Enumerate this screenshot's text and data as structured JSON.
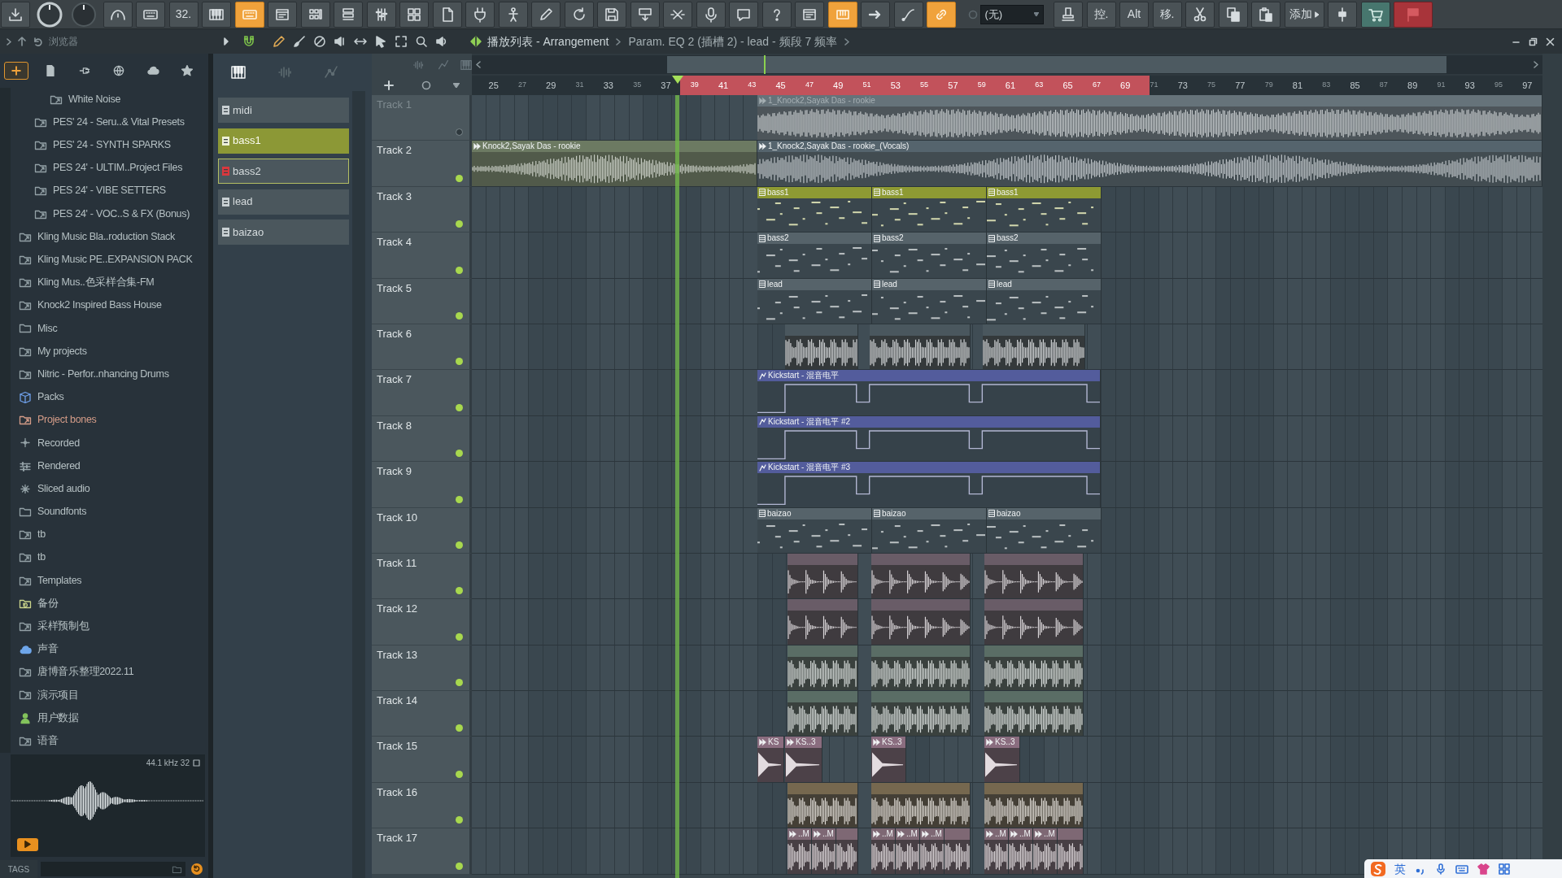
{
  "toolbar": {
    "left": [
      {
        "kind": "icon",
        "active": false
      },
      {
        "kind": "knob",
        "active": false
      },
      {
        "kind": "knob",
        "active": false
      },
      {
        "kind": "icon",
        "active": false
      },
      {
        "kind": "icon",
        "active": false
      },
      {
        "kind": "text",
        "label": "32.",
        "active": false
      },
      {
        "kind": "icon",
        "active": false
      },
      {
        "kind": "icon",
        "active": true
      },
      {
        "kind": "icon",
        "active": false
      },
      {
        "kind": "icon",
        "active": false
      },
      {
        "kind": "icon",
        "active": false
      },
      {
        "kind": "icon",
        "active": false
      },
      {
        "kind": "icon",
        "active": false
      },
      {
        "kind": "icon",
        "active": false
      },
      {
        "kind": "icon",
        "active": false
      },
      {
        "kind": "icon",
        "active": false
      },
      {
        "kind": "icon",
        "active": false
      },
      {
        "kind": "icon",
        "active": false
      },
      {
        "kind": "icon",
        "active": false
      },
      {
        "kind": "icon",
        "active": false
      },
      {
        "kind": "icon",
        "active": false
      },
      {
        "kind": "icon",
        "active": false
      },
      {
        "kind": "icon",
        "active": false
      },
      {
        "kind": "icon",
        "active": false
      },
      {
        "kind": "icon",
        "active": false
      },
      {
        "kind": "icon",
        "active": true
      },
      {
        "kind": "icon",
        "active": false
      },
      {
        "kind": "icon",
        "active": false
      },
      {
        "kind": "icon",
        "active": true
      }
    ],
    "selector": {
      "value": "(无)"
    },
    "right": [
      {
        "kind": "icon",
        "active": false
      },
      {
        "kind": "text",
        "label": "控.",
        "active": false
      },
      {
        "kind": "text",
        "label": "Alt",
        "active": false
      },
      {
        "kind": "text",
        "label": "移.",
        "active": false
      },
      {
        "kind": "icon",
        "active": false
      },
      {
        "kind": "icon",
        "active": false
      },
      {
        "kind": "icon",
        "active": false
      },
      {
        "kind": "menu",
        "label": "添加",
        "active": false
      },
      {
        "kind": "icon",
        "active": false
      },
      {
        "kind": "icon",
        "active": false
      },
      {
        "kind": "icon",
        "active": false
      }
    ]
  },
  "browser": {
    "title": "浏览器",
    "tabs": [
      {
        "selected": true
      },
      {
        "selected": false
      },
      {
        "selected": false
      },
      {
        "selected": false
      },
      {
        "selected": false
      },
      {
        "selected": false
      }
    ],
    "items": [
      {
        "children": [
          {
            "children": [
              {
                "label": "White Noise",
                "kind": "linked"
              }
            ]
          },
          {
            "label": "PES' 24 - Seru..& Vital Presets",
            "kind": "linked"
          },
          {
            "label": "PES' 24 - SYNTH SPARKS",
            "kind": "linked"
          },
          {
            "label": "PES 24' - ULTIM..Project Files",
            "kind": "linked"
          },
          {
            "label": "PES 24' - VIBE SETTERS",
            "kind": "linked"
          },
          {
            "label": "PES 24' - VOC..S & FX (Bonus)",
            "kind": "linked"
          }
        ]
      },
      {
        "label": "Kling Music Bla..roduction Stack",
        "kind": "linked"
      },
      {
        "label": "Kling Music PE..EXPANSION PACK",
        "kind": "linked"
      },
      {
        "label": "Kling Mus..色采样合集-FM",
        "kind": "linked"
      },
      {
        "label": "Knock2 Inspired Bass House",
        "kind": "linked"
      },
      {
        "label": "Misc",
        "kind": "folder"
      },
      {
        "label": "My projects",
        "kind": "linked"
      },
      {
        "label": "Nitric - Perfor..nhancing Drums",
        "kind": "linked"
      },
      {
        "label": "Packs",
        "kind": "packs"
      },
      {
        "label": "Project bones",
        "kind": "linked",
        "color": "#d49c88"
      },
      {
        "label": "Recorded",
        "kind": "recorded"
      },
      {
        "label": "Rendered",
        "kind": "rendered"
      },
      {
        "label": "Sliced audio",
        "kind": "sliced"
      },
      {
        "label": "Soundfonts",
        "kind": "folder"
      },
      {
        "label": "tb",
        "kind": "linked"
      },
      {
        "label": "tb",
        "kind": "linked"
      },
      {
        "label": "Templates",
        "kind": "linked"
      },
      {
        "label": "备份",
        "kind": "backup"
      },
      {
        "label": "采样预制包",
        "kind": "linked"
      },
      {
        "label": "声音",
        "kind": "cloud"
      },
      {
        "label": "唐博音乐整理2022.11",
        "kind": "linked"
      },
      {
        "label": "演示项目",
        "kind": "linked"
      },
      {
        "label": "用户数据",
        "kind": "user"
      },
      {
        "label": "语音",
        "kind": "linked"
      }
    ],
    "preview": {
      "info": "44.1 kHz 32"
    },
    "tags": {
      "label": "TAGS"
    }
  },
  "playlist": {
    "title": "播放列表 - Arrangement",
    "breadcrumb": "Param. EQ 2 (插槽 2) - lead - 频段 7 频率",
    "picker_filters": [
      {
        "selected": true
      },
      {
        "selected": false
      },
      {
        "selected": false
      }
    ],
    "patterns": [
      {
        "label": "midi",
        "selected": false,
        "focused": false,
        "color": "#c9d0d3"
      },
      {
        "label": "bass1",
        "selected": true,
        "focused": false,
        "color": "#eef1d8"
      },
      {
        "label": "bass2",
        "selected": false,
        "focused": true,
        "color": "#d9383e"
      },
      {
        "label": "lead",
        "selected": false,
        "focused": false,
        "color": "#c9d0d3"
      },
      {
        "label": "baizao",
        "selected": false,
        "focused": false,
        "color": "#c9d0d3"
      }
    ],
    "ruler": [
      "25",
      "27",
      "29",
      "31",
      "33",
      "35",
      "37",
      "39",
      "41",
      "43",
      "45",
      "47",
      "49",
      "51",
      "53",
      "55",
      "57",
      "59",
      "61",
      "63",
      "65",
      "67",
      "69",
      "71",
      "73",
      "75",
      "77",
      "79",
      "81",
      "83",
      "85",
      "87",
      "89",
      "91",
      "93",
      "95",
      "97"
    ],
    "tracks": [
      {
        "label": "Track 1",
        "muted": true,
        "clips": [
          {
            "kind": "audio",
            "label": "1_Knock2,Sayak Das - rookie",
            "color": "#66737a"
          }
        ]
      },
      {
        "label": "Track 2",
        "muted": false,
        "clips": [
          {
            "kind": "audio",
            "label": "Knock2,Sayak Das - rookie",
            "color": "#6c7a62"
          },
          {
            "kind": "audio",
            "label": "1_Knock2,Sayak Das - rookie_(Vocals)",
            "color": "#55646d"
          }
        ]
      },
      {
        "label": "Track 3",
        "muted": false,
        "clips": [
          {
            "kind": "pattern",
            "label": "bass1",
            "color": "#8e9a33"
          },
          {
            "kind": "pattern",
            "label": "bass1",
            "color": "#8e9a33"
          },
          {
            "kind": "pattern",
            "label": "bass1",
            "color": "#8e9a33"
          }
        ]
      },
      {
        "label": "Track 4",
        "muted": false,
        "clips": [
          {
            "kind": "pattern",
            "label": "bass2",
            "color": "#56636a"
          },
          {
            "kind": "pattern",
            "label": "bass2",
            "color": "#56636a"
          },
          {
            "kind": "pattern",
            "label": "bass2",
            "color": "#56636a"
          }
        ]
      },
      {
        "label": "Track 5",
        "muted": false,
        "clips": [
          {
            "kind": "pattern",
            "label": "lead",
            "color": "#56636a"
          },
          {
            "kind": "pattern",
            "label": "lead",
            "color": "#56636a"
          },
          {
            "kind": "pattern",
            "label": "lead",
            "color": "#56636a"
          }
        ]
      },
      {
        "label": "Track 6",
        "muted": false,
        "clips": [
          {
            "kind": "audio",
            "color": "#4a575e"
          },
          {
            "kind": "audio",
            "color": "#4a575e"
          },
          {
            "kind": "audio",
            "color": "#4a575e"
          }
        ]
      },
      {
        "label": "Track 7",
        "muted": false,
        "clips": [
          {
            "kind": "automation",
            "label": "Kickstart - 混音电平",
            "color": "#535c9c"
          }
        ]
      },
      {
        "label": "Track 8",
        "muted": false,
        "clips": [
          {
            "kind": "automation",
            "label": "Kickstart - 混音电平 #2",
            "color": "#535c9c"
          }
        ]
      },
      {
        "label": "Track 9",
        "muted": false,
        "clips": [
          {
            "kind": "automation",
            "label": "Kickstart - 混音电平 #3",
            "color": "#535c9c"
          }
        ]
      },
      {
        "label": "Track 10",
        "muted": false,
        "clips": [
          {
            "kind": "pattern",
            "label": "baizao",
            "color": "#56636a"
          },
          {
            "kind": "pattern",
            "label": "baizao",
            "color": "#56636a"
          },
          {
            "kind": "pattern",
            "label": "baizao",
            "color": "#56636a"
          }
        ]
      },
      {
        "label": "Track 11",
        "muted": false,
        "clips": [
          {
            "kind": "audio",
            "color": "#695c67"
          },
          {
            "kind": "audio",
            "color": "#695c67"
          },
          {
            "kind": "audio",
            "color": "#695c67"
          }
        ]
      },
      {
        "label": "Track 12",
        "muted": false,
        "clips": [
          {
            "kind": "audio",
            "color": "#695c67"
          },
          {
            "kind": "audio",
            "color": "#695c67"
          },
          {
            "kind": "audio",
            "color": "#695c67"
          }
        ]
      },
      {
        "label": "Track 13",
        "muted": false,
        "clips": [
          {
            "kind": "audio",
            "color": "#5a6d65"
          },
          {
            "kind": "audio",
            "color": "#5a6d65"
          },
          {
            "kind": "audio",
            "color": "#5a6d65"
          }
        ]
      },
      {
        "label": "Track 14",
        "muted": false,
        "clips": [
          {
            "kind": "audio",
            "color": "#5a6d65"
          },
          {
            "kind": "audio",
            "color": "#5a6d65"
          },
          {
            "kind": "audio",
            "color": "#5a6d65"
          }
        ]
      },
      {
        "label": "Track 15",
        "muted": false,
        "clips": [
          {
            "kind": "audio",
            "label": "KS",
            "color": "#8a6d7f"
          },
          {
            "kind": "audio",
            "label": "KS..3",
            "color": "#8a6d7f"
          },
          {
            "kind": "audio",
            "label": "KS..3",
            "color": "#8a6d7f"
          },
          {
            "kind": "audio",
            "label": "KS..3",
            "color": "#8a6d7f"
          }
        ]
      },
      {
        "label": "Track 16",
        "muted": false,
        "clips": [
          {
            "kind": "audio",
            "color": "#76684f"
          },
          {
            "kind": "audio",
            "color": "#76684f"
          },
          {
            "kind": "audio",
            "color": "#76684f"
          }
        ]
      },
      {
        "label": "Track 17",
        "muted": false,
        "clips": [
          {
            "kind": "audio",
            "label": "..M",
            "color": "#7e6874"
          },
          {
            "kind": "audio",
            "label": "..M",
            "color": "#7e6874"
          },
          {
            "kind": "audio",
            "color": "#7e6874"
          },
          {
            "kind": "audio",
            "label": "..M",
            "color": "#7e6874"
          },
          {
            "kind": "audio",
            "label": "..M",
            "color": "#7e6874"
          },
          {
            "kind": "audio",
            "label": "..M",
            "color": "#7e6874"
          },
          {
            "kind": "audio",
            "color": "#7e6874"
          },
          {
            "kind": "audio",
            "label": "..M",
            "color": "#7e6874"
          },
          {
            "kind": "audio",
            "label": "..M",
            "color": "#7e6874"
          },
          {
            "kind": "audio",
            "label": "..M",
            "color": "#7e6874"
          },
          {
            "kind": "audio",
            "color": "#7e6874"
          }
        ]
      }
    ]
  },
  "ime": {
    "mode": "英"
  }
}
